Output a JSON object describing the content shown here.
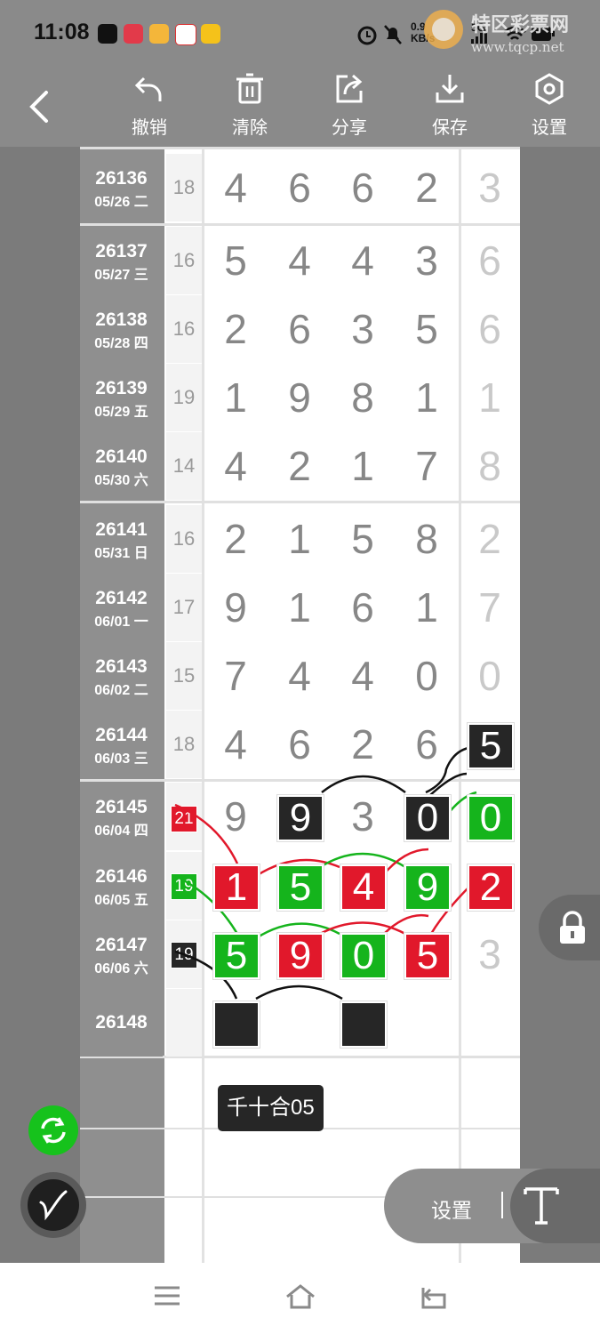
{
  "status": {
    "time": "11:08",
    "speed": "0.9",
    "speed_unit": "KB/s",
    "net": "5G"
  },
  "watermark": {
    "line1": "特区彩票网",
    "line2": "www.tqcp.net"
  },
  "toolbar": {
    "undo": "撤销",
    "clear": "清除",
    "share": "分享",
    "save": "保存",
    "settings": "设置"
  },
  "rows": [
    {
      "id": "26136",
      "date": "05/26 二",
      "sum": "18",
      "digits": [
        "4",
        "6",
        "6",
        "2",
        "3"
      ]
    },
    {
      "id": "26137",
      "date": "05/27 三",
      "sum": "16",
      "digits": [
        "5",
        "4",
        "4",
        "3",
        "6"
      ]
    },
    {
      "id": "26138",
      "date": "05/28 四",
      "sum": "16",
      "digits": [
        "2",
        "6",
        "3",
        "5",
        "6"
      ]
    },
    {
      "id": "26139",
      "date": "05/29 五",
      "sum": "19",
      "digits": [
        "1",
        "9",
        "8",
        "1",
        "1"
      ]
    },
    {
      "id": "26140",
      "date": "05/30 六",
      "sum": "14",
      "digits": [
        "4",
        "2",
        "1",
        "7",
        "8"
      ]
    },
    {
      "id": "26141",
      "date": "05/31 日",
      "sum": "16",
      "digits": [
        "2",
        "1",
        "5",
        "8",
        "2"
      ]
    },
    {
      "id": "26142",
      "date": "06/01 一",
      "sum": "17",
      "digits": [
        "9",
        "1",
        "6",
        "1",
        "7"
      ]
    },
    {
      "id": "26143",
      "date": "06/02 二",
      "sum": "15",
      "digits": [
        "7",
        "4",
        "4",
        "0",
        "0"
      ]
    },
    {
      "id": "26144",
      "date": "06/03 三",
      "sum": "18",
      "digits": [
        "4",
        "6",
        "2",
        "6",
        "5"
      ]
    },
    {
      "id": "26145",
      "date": "06/04 四",
      "sum": "21",
      "digits": [
        "9",
        "9",
        "3",
        "0",
        "0"
      ]
    },
    {
      "id": "26146",
      "date": "06/05 五",
      "sum": "19",
      "digits": [
        "1",
        "5",
        "4",
        "9",
        "2"
      ]
    },
    {
      "id": "26147",
      "date": "06/06 六",
      "sum": "19",
      "digits": [
        "5",
        "9",
        "0",
        "5",
        "3"
      ]
    },
    {
      "id": "26148",
      "date": "",
      "sum": "",
      "digits": [
        "",
        "",
        "",
        "",
        ""
      ]
    }
  ],
  "tooltip": "千十合05",
  "buttons": {
    "settings": "设置"
  },
  "colors": {
    "red": "#e1182b",
    "green": "#15b41c",
    "black": "#262626"
  }
}
